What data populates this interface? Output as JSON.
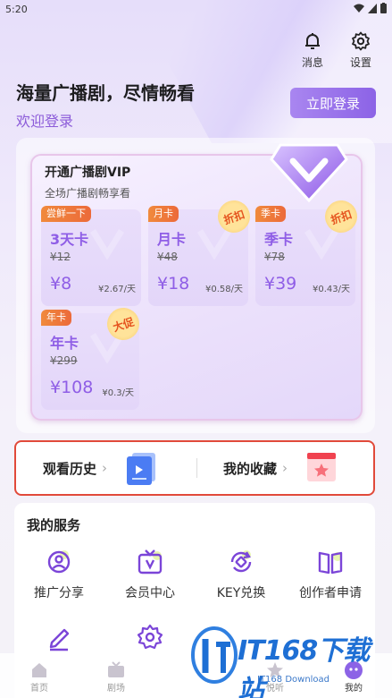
{
  "status_bar": {
    "time": "5:20"
  },
  "top_actions": [
    {
      "label": "消息",
      "icon": "bell-icon"
    },
    {
      "label": "设置",
      "icon": "gear-icon"
    }
  ],
  "header": {
    "headline": "海量广播剧，尽情畅看",
    "welcome": "欢迎登录",
    "login_button": "立即登录"
  },
  "vip": {
    "title": "开通广播剧VIP",
    "subtitle": "全场广播剧畅享看",
    "plans": [
      {
        "badge": "尝鲜一下",
        "name": "3天卡",
        "original": "¥12",
        "price": "¥8",
        "unit": "¥2.67/天",
        "tag": ""
      },
      {
        "badge": "月卡",
        "name": "月卡",
        "original": "¥48",
        "price": "¥18",
        "unit": "¥0.58/天",
        "tag": "折扣"
      },
      {
        "badge": "季卡",
        "name": "季卡",
        "original": "¥78",
        "price": "¥39",
        "unit": "¥0.43/天",
        "tag": "折扣"
      },
      {
        "badge": "年卡",
        "name": "年卡",
        "original": "¥299",
        "price": "¥108",
        "unit": "¥0.3/天",
        "tag": "大促"
      }
    ]
  },
  "quick_links": [
    {
      "label": "观看历史",
      "icon": "video-history-icon"
    },
    {
      "label": "我的收藏",
      "icon": "favorites-icon"
    }
  ],
  "services": {
    "title": "我的服务",
    "items": [
      {
        "label": "推广分享",
        "icon": "share-person-icon"
      },
      {
        "label": "会员中心",
        "icon": "vip-tv-icon"
      },
      {
        "label": "KEY兑换",
        "icon": "key-exchange-icon"
      },
      {
        "label": "创作者申请",
        "icon": "book-icon"
      },
      {
        "label": "",
        "icon": "edit-icon"
      },
      {
        "label": "",
        "icon": "settings-flower-icon"
      }
    ]
  },
  "tabbar": [
    {
      "label": "首页",
      "icon": "home-icon",
      "active": false
    },
    {
      "label": "剧场",
      "icon": "tv-icon",
      "active": false
    },
    {
      "label": "悦听",
      "icon": "star-icon",
      "active": false
    },
    {
      "label": "我的",
      "icon": "profile-icon",
      "active": true
    }
  ],
  "watermark": {
    "brand": "IT168下载站",
    "sub": "IT168 Download"
  },
  "colors": {
    "accent": "#8c63e6",
    "badge": "#ec6a3a",
    "highlight_border": "#e14a3a"
  }
}
